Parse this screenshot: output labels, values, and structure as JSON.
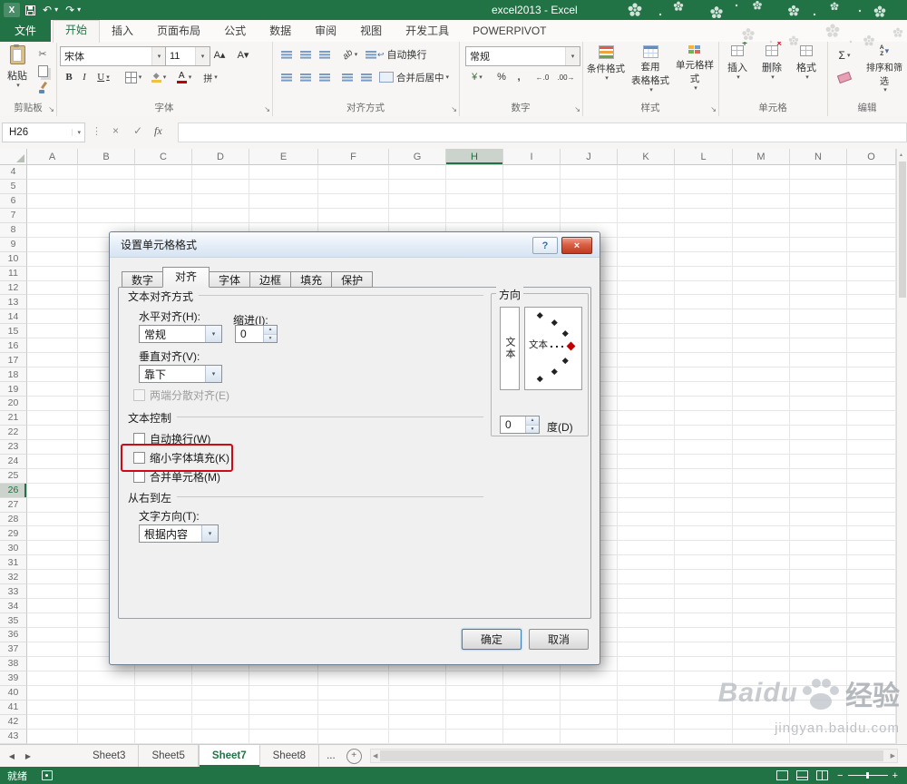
{
  "app": {
    "title": "excel2013 - Excel",
    "accent": "#217346",
    "annotation_red": "#cf0a18"
  },
  "glyphs": {
    "app": "X",
    "caret": "▾",
    "launcher": "↘",
    "undo": "↶",
    "redo": "↷",
    "close": "×",
    "help": "?",
    "check": "✓",
    "cross": "×",
    "fx": "fx",
    "scissors": "✂",
    "sum": "Σ",
    "yen": "¥",
    "percent": "%",
    "comma": ",",
    "inc_decimal": "←.0",
    "dec_decimal": ".00→",
    "bold": "B",
    "italic": "I",
    "underline": "U",
    "phonetic": "拼",
    "ab": "ab",
    "font_grow": "A▴",
    "font_shrink": "A▾",
    "left_tri": "◀",
    "right_tri": "▶",
    "up": "▴",
    "down": "▾",
    "dots": "⋮",
    "wrap_arrow": "↩",
    "sort_a": "A",
    "sort_z": "Z",
    "plus": "+",
    "minus": "−"
  },
  "ribbon_tabs": [
    {
      "label": "文件",
      "type": "file"
    },
    {
      "label": "开始",
      "active": true
    },
    {
      "label": "插入"
    },
    {
      "label": "页面布局"
    },
    {
      "label": "公式"
    },
    {
      "label": "数据"
    },
    {
      "label": "审阅"
    },
    {
      "label": "视图"
    },
    {
      "label": "开发工具"
    },
    {
      "label": "POWERPIVOT"
    }
  ],
  "ribbon": {
    "clipboard": {
      "group": "剪贴板",
      "paste": "粘贴"
    },
    "font": {
      "group": "字体",
      "name": "宋体",
      "size": "11"
    },
    "alignment": {
      "group": "对齐方式",
      "wrap": "自动换行",
      "merge": "合并后居中"
    },
    "number": {
      "group": "数字",
      "format": "常规"
    },
    "styles": {
      "group": "样式",
      "conditional": "条件格式",
      "table_line1": "套用",
      "table_line2": "表格格式",
      "cell": "单元格样式"
    },
    "cells": {
      "group": "单元格",
      "insert": "插入",
      "delete": "删除",
      "format": "格式"
    },
    "editing": {
      "group": "编辑",
      "sort": "排序和筛选"
    }
  },
  "formula_bar": {
    "name_box": "H26",
    "value": ""
  },
  "grid": {
    "columns": [
      "A",
      "B",
      "C",
      "D",
      "E",
      "F",
      "G",
      "H",
      "I",
      "J",
      "K",
      "L",
      "M",
      "N",
      "O"
    ],
    "selected_column": "H",
    "row_start": 4,
    "row_end": 43,
    "selected_row": 26
  },
  "dialog": {
    "title": "设置单元格格式",
    "tabs": [
      "数字",
      "对齐",
      "字体",
      "边框",
      "填充",
      "保护"
    ],
    "active_tab": "对齐",
    "align": {
      "section_text": "文本对齐方式",
      "horizontal_label": "水平对齐(H):",
      "horizontal_value": "常规",
      "indent_label": "缩进(I):",
      "indent_value": "0",
      "vertical_label": "垂直对齐(V):",
      "vertical_value": "靠下",
      "justify_distributed": "两端分散对齐(E)",
      "section_control": "文本控制",
      "wrap": "自动换行(W)",
      "shrink": "缩小字体填充(K)",
      "merge": "合并单元格(M)",
      "section_rtl": "从右到左",
      "text_direction_label": "文字方向(T):",
      "text_direction_value": "根据内容",
      "orientation_label": "方向",
      "orientation_text_vertical": "文本",
      "orientation_text": "文本",
      "degrees_value": "0",
      "degrees_label": "度(D)"
    },
    "ok": "确定",
    "cancel": "取消"
  },
  "sheets": {
    "tabs": [
      "Sheet3",
      "Sheet5",
      "Sheet7",
      "Sheet8"
    ],
    "active": "Sheet7",
    "more": "...",
    "add": "+"
  },
  "status": {
    "ready": "就绪"
  },
  "watermark": {
    "brand_latin": "Baidu",
    "brand_cn": "经验",
    "url": "jingyan.baidu.com"
  }
}
